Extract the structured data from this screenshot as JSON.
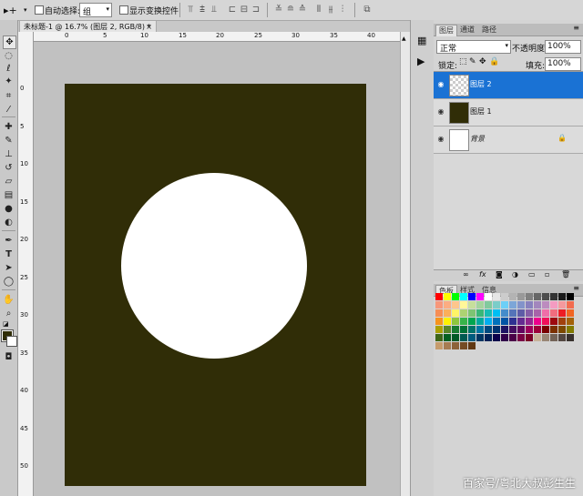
{
  "options_bar": {
    "auto_select_label": "自动选择:",
    "auto_select_value": "组",
    "show_transform_label": "显示变换控件"
  },
  "document": {
    "tab_title": "未标题-1 @ 16.7% (图层 2, RGB/8) *",
    "close_glyph": "×",
    "ruler_top_numbers": [
      "0",
      "5",
      "10",
      "15",
      "20",
      "25",
      "30",
      "35",
      "40"
    ],
    "ruler_left_numbers": [
      "0",
      "5",
      "10",
      "15",
      "20",
      "25",
      "30",
      "35",
      "40",
      "45",
      "50"
    ],
    "canvas_color": "#302d07",
    "circle_color": "#ffffff"
  },
  "layers_panel": {
    "tabs": [
      "图层",
      "通道",
      "路径"
    ],
    "blend_mode": "正常",
    "opacity_label": "不透明度:",
    "opacity_value": "100%",
    "lock_label": "锁定:",
    "fill_label": "填充:",
    "fill_value": "100%",
    "layers": [
      {
        "name": "图层 2",
        "selected": true
      },
      {
        "name": "图层 1",
        "selected": false
      },
      {
        "name": "背景",
        "selected": false
      }
    ]
  },
  "swatches_panel": {
    "tabs": [
      "色板",
      "样式",
      "信息"
    ]
  },
  "watermark": "百家号/粤北大叔彭生生"
}
